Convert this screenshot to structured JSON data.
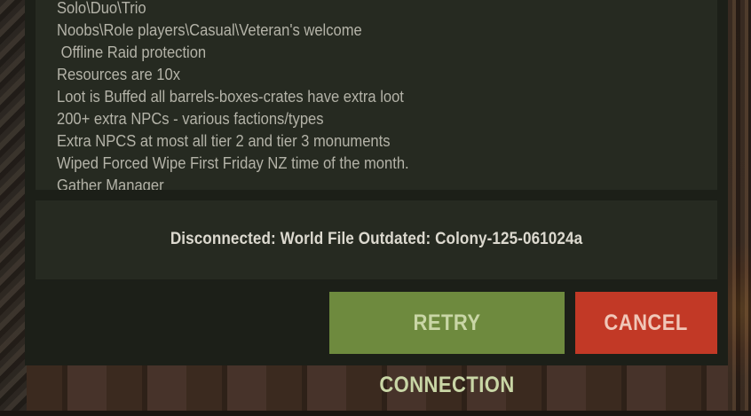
{
  "description": {
    "lines": [
      "Solo\\Duo\\Trio",
      "Noobs\\Role players\\Casual\\Veteran's welcome",
      " Offline Raid protection",
      "Resources are 10x",
      "Loot is Buffed all barrels-boxes-crates have extra loot",
      "200+ extra NPCs - various factions/types",
      "Extra NPCS at most all tier 2 and tier 3 monuments",
      "Wiped Forced Wipe First Friday NZ time of the month.",
      "Gather Manager"
    ]
  },
  "status": {
    "message": "Disconnected: World File Outdated: Colony-125-061024a"
  },
  "buttons": {
    "retry_label": "RETRY CONNECTION",
    "cancel_label": "CANCEL"
  },
  "colors": {
    "retry": "#6e8a3e",
    "cancel": "#c23926",
    "panel": "#262a21",
    "dialog": "#1c1f18"
  }
}
